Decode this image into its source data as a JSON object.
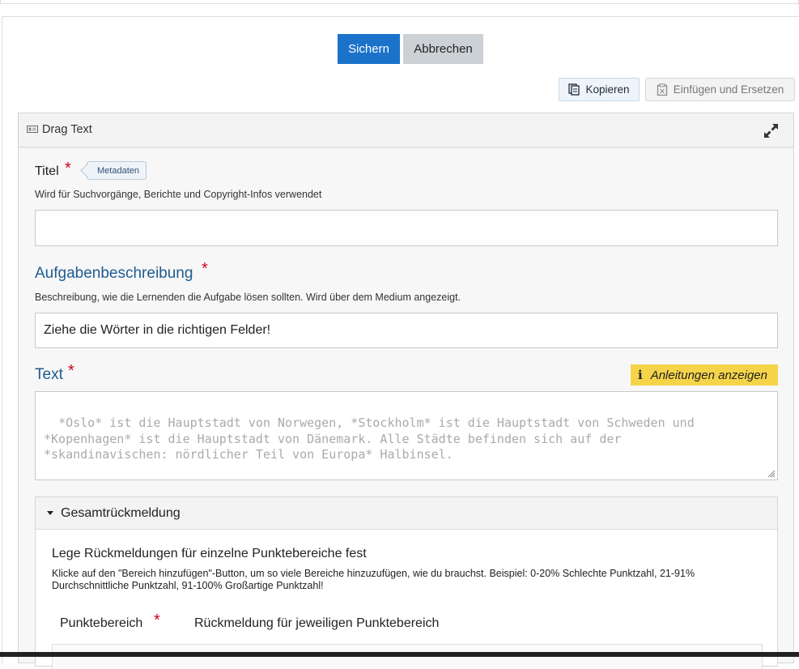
{
  "toolbar": {
    "save": "Sichern",
    "cancel": "Abbrechen",
    "copy": "Kopieren",
    "paste": "Einfügen und Ersetzen"
  },
  "panel": {
    "title": "Drag Text"
  },
  "fields": {
    "title": {
      "label": "Titel",
      "required": "*",
      "badge": "Metadaten",
      "description": "Wird für Suchvorgänge, Berichte und Copyright-Infos verwendet",
      "value": ""
    },
    "task": {
      "label": "Aufgabenbeschreibung",
      "required": "*",
      "description": "Beschreibung, wie die Lernenden die Aufgabe lösen sollten. Wird über dem Medium angezeigt.",
      "value": "Ziehe die Wörter in die richtigen Felder!"
    },
    "text": {
      "label": "Text",
      "required": "*",
      "guide_button": "Anleitungen anzeigen",
      "placeholder": "*Oslo* ist die Hauptstadt von Norwegen, *Stockholm* ist die Hauptstadt von Schweden und\n*Kopenhagen* ist die Hauptstadt von Dänemark. Alle Städte befinden sich auf der\n*skandinavischen: nördlicher Teil von Europa* Halbinsel."
    }
  },
  "feedback": {
    "title": "Gesamtrückmeldung",
    "subtitle": "Lege Rückmeldungen für einzelne Punktebereiche fest",
    "description": "Klicke auf den \"Bereich hinzufügen\"-Button, um so viele Bereiche hinzuzufügen, wie du brauchst. Beispiel: 0-20% Schlechte Punktzahl, 21-91% Durchschnittliche Punktzahl, 91-100% Großartige Punktzahl!",
    "col_range": "Punktebereich",
    "col_range_required": "*",
    "col_feedback": "Rückmeldung für jeweiligen Punktebereich"
  },
  "colors": {
    "primary": "#1a73c9",
    "required": "#d0021b",
    "label_blue": "#1f5b8e",
    "guide": "#f5d44a"
  }
}
